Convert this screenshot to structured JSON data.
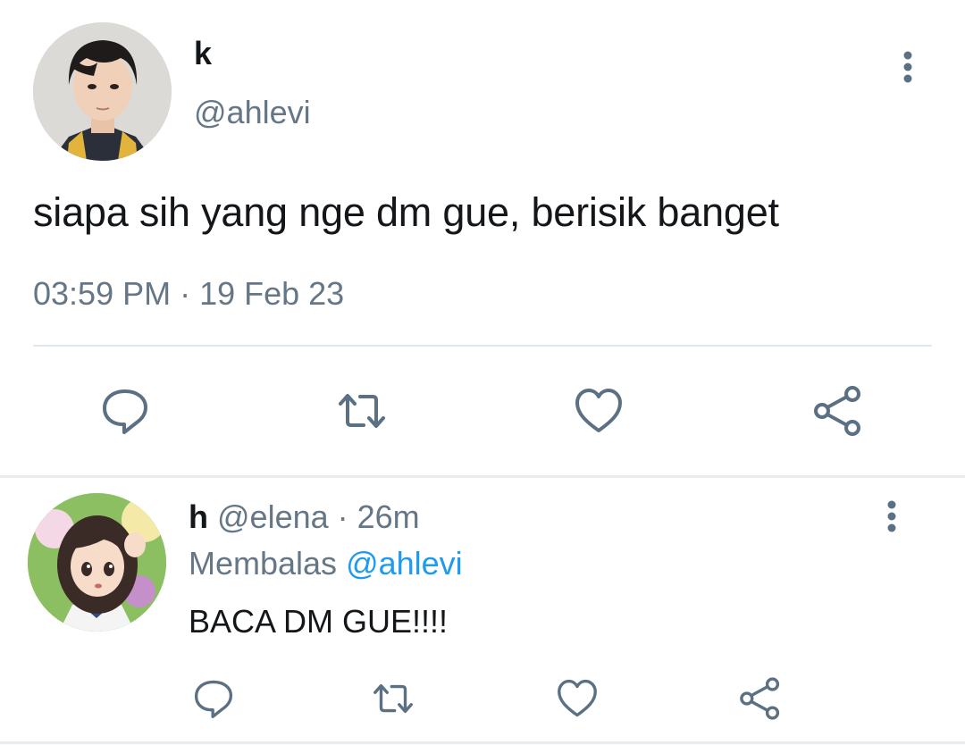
{
  "main_tweet": {
    "display_name": "k",
    "handle": "@ahlevi",
    "text": "siapa sih yang nge dm gue, berisik banget",
    "timestamp": "03:59 PM · 19 Feb 23",
    "actions": [
      "reply-icon",
      "retweet-icon",
      "like-icon",
      "share-icon"
    ]
  },
  "reply_tweet": {
    "display_name": "h",
    "meta": " @elena · 26m",
    "replying_label": "Membalas ",
    "replying_to": "@ahlevi",
    "text": "BACA DM GUE!!!!",
    "actions": [
      "reply-icon",
      "retweet-icon",
      "like-icon",
      "share-icon"
    ]
  },
  "colors": {
    "text_primary": "#14171a",
    "text_secondary": "#657786",
    "link": "#1d9bf0",
    "icon": "#5b7083",
    "divider": "#e1e8ed"
  }
}
